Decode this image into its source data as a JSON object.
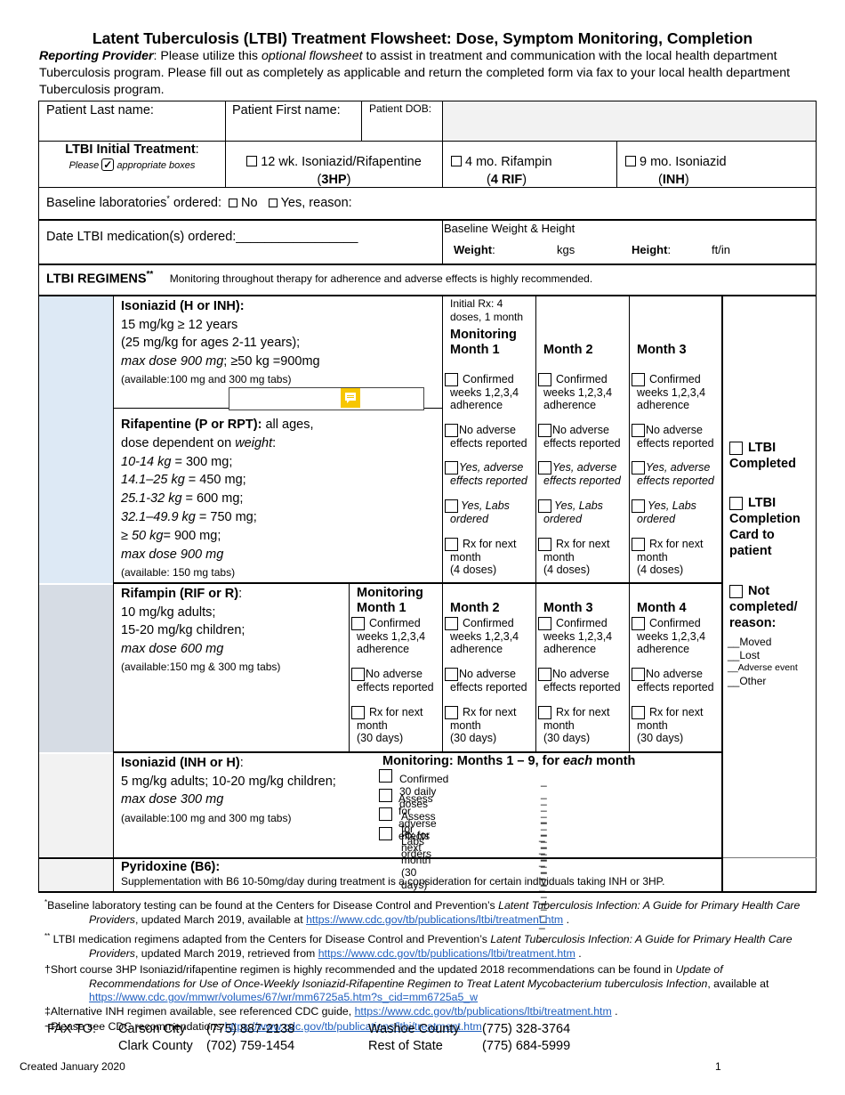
{
  "document": {
    "title": "Latent Tuberculosis (LTBI) Treatment Flowsheet: Dose, Symptom Monitoring, Completion",
    "intro_lead": "Reporting Provider",
    "intro_part1": ": Please utilize this ",
    "intro_italic": "optional flowsheet",
    "intro_part2": " to assist in treatment and communication with the local health department Tuberculosis program. Please fill out as completely as applicable and return the completed form via fax to your local health department Tuberculosis program."
  },
  "patient": {
    "last_name_label": "Patient Last name:",
    "first_name_label": "Patient First name:",
    "dob_label": "Patient DOB:"
  },
  "initial_treatment": {
    "label": "LTBI Initial Treatment",
    "colon": ":",
    "note_before": "Please",
    "note_after": "appropriate boxes",
    "options": [
      {
        "line1": "12 wk. Isoniazid/Rifapentine",
        "open": "(",
        "code": "3HP",
        "close": ")"
      },
      {
        "line1": "4 mo. Rifampin",
        "open": "(",
        "code": "4 RIF",
        "close": ")"
      },
      {
        "line1": "9 mo. Isoniazid",
        "open": "(",
        "code": "INH",
        "close": ")"
      }
    ]
  },
  "baseline_labs": {
    "label": "Baseline laboratories",
    "mark": "*",
    "ordered": " ordered:",
    "no": "No",
    "yes": "Yes, reason:"
  },
  "date_ordered": {
    "label": "Date LTBI medication(s) ordered:",
    "blank": "_________________"
  },
  "baseline_wh": {
    "title": "Baseline Weight & Height",
    "weight_label": "Weight",
    "weight_unit": "kgs",
    "height_label": "Height",
    "height_unit": "ft/in"
  },
  "regimens_header": {
    "title": "LTBI REGIMENS",
    "mark": "**",
    "note": "Monitoring throughout therapy for adherence and adverse effects is highly recommended."
  },
  "isoniazid_3hp": {
    "name": "Isoniazid (H or INH):",
    "line1": "15 mg/kg ≥ 12 years",
    "line2": "(25 mg/kg for ages 2-11 years);",
    "line3_italic": "max dose 900 mg",
    "line3_rest": "; ≥50 kg =900mg",
    "avail": "(available:100 mg and 300 mg tabs)"
  },
  "rifapentine": {
    "name": "Rifapentine (P or RPT):",
    "name_rest": " all ages,",
    "line1_a": "dose dependent on ",
    "line1_b": "weight",
    "line1_c": ":",
    "doses": [
      {
        "range": "10-14 kg",
        "dose": " = 300 mg;"
      },
      {
        "range": "14.1–25 kg",
        "dose": " = 450 mg;"
      },
      {
        "range": "25.1-32 kg",
        "dose": " = 600 mg;"
      },
      {
        "range": "32.1–49.9 kg",
        "dose": " = 750 mg;"
      },
      {
        "range": "≥ 50 kg",
        "dose": "= 900 mg;"
      }
    ],
    "max": "max dose 900 mg",
    "avail": "(available: 150 mg tabs)"
  },
  "hp_monitoring": {
    "initial_rx": "Initial Rx: 4 doses, 1 month",
    "months": [
      {
        "head1": "Monitoring",
        "head2": "Month 1"
      },
      {
        "head1": "",
        "head2": "Month 2"
      },
      {
        "head1": "",
        "head2": "Month 3"
      }
    ],
    "items": {
      "confirmed": [
        "Confirmed",
        "weeks 1,2,3,4",
        "adherence"
      ],
      "no_adverse": [
        "No adverse",
        "effects reported"
      ],
      "yes_adverse": [
        "Yes, adverse",
        "effects reported"
      ],
      "labs": [
        "Yes, Labs",
        "ordered"
      ],
      "rx": [
        "Rx for next",
        "month",
        "(4 doses)"
      ]
    }
  },
  "completion": {
    "completed": [
      "LTBI",
      "Completed"
    ],
    "card": [
      "LTBI",
      "Completion",
      "Card to",
      "patient"
    ],
    "not_completed": [
      "Not",
      "completed/",
      "reason:"
    ],
    "reasons": [
      "__Moved",
      "__Lost",
      "__Adverse event",
      "__Other"
    ]
  },
  "rifampin": {
    "name": "Rifampin (RIF or R)",
    "colon": ":",
    "line1": "10 mg/kg adults;",
    "line2": "15-20 mg/kg children;",
    "max": "max dose 600 mg",
    "avail": "(available:150 mg & 300 mg tabs)",
    "months": [
      {
        "head1": "Monitoring",
        "head2": "Month 1"
      },
      {
        "head1": "",
        "head2": "Month 2"
      },
      {
        "head1": "",
        "head2": "Month 3"
      },
      {
        "head1": "",
        "head2": "Month 4"
      }
    ],
    "items": {
      "confirmed": [
        "Confirmed",
        "weeks 1,2,3,4",
        "adherence"
      ],
      "no_adverse": [
        "No adverse",
        "effects reported"
      ],
      "rx": [
        "Rx for next",
        "month",
        "(30 days)"
      ]
    }
  },
  "isoniazid_9": {
    "name": "Isoniazid (INH or H)",
    "colon": ":",
    "line1": "5 mg/kg adults; 10-20 mg/kg children;",
    "max": "max dose 300 mg",
    "avail": "(available:100 mg and 300 mg tabs)",
    "monitor_a": "Monitoring: Months 1 – 9, for ",
    "monitor_b": "each",
    "monitor_c": " month",
    "items": [
      {
        "label": "Confirmed 30 daily doses",
        "blank": "_ _ _ _ _ _ _ _ _"
      },
      {
        "label": "Assess for adverse effects",
        "blank": "_ _ _ _ _ _ _ _ _"
      },
      {
        "label": "Assess for Labs orders",
        "blank": "_ _ _ _ _ _ _ _ _"
      },
      {
        "label": "Rx for next month (30 days)",
        "blank": "_ _ _ _ _ _ _ _ _"
      }
    ]
  },
  "pyridoxine": {
    "name": "Pyridoxine (B6):",
    "text": "Supplementation with B6 10-50mg/day during treatment is a consideration for certain individuals taking INH or 3HP."
  },
  "footnotes": {
    "f1_mark": "*",
    "f1_a": "Baseline laboratory testing can be found at the Centers for Disease Control and Prevention’s ",
    "f1_b": "Latent Tuberculosis Infection: A Guide for Primary Health Care",
    "f1_c": "Providers",
    "f1_d": ", updated March 2019, available at ",
    "f1_link": "https://www.cdc.gov/tb/publications/ltbi/treatment.htm",
    "f1_end": " .",
    "f2_mark": "**",
    "f2_a": " LTBI medication regimens adapted from the Centers for Disease Control and Prevention’s ",
    "f2_b": "Latent Tuberculosis Infection: A Guide for Primary Health Care",
    "f2_c": "Providers",
    "f2_d": ", updated March 2019, retrieved from ",
    "f2_link": "https://www.cdc.gov/tb/publications/ltbi/treatment.htm",
    "f2_end": " .",
    "f3_mark": "†",
    "f3_a": "Short course 3HP Isoniazid/rifapentine regimen is highly recommended and the updated 2018 recommendations can be found in ",
    "f3_b": "Update of",
    "f3_c": "Recommendations for Use of Once-Weekly Isoniazid-Rifapentine Regimen to Treat Latent Mycobacterium tuberculosis Infection",
    "f3_d": ", available at",
    "f3_link": "https://www.cdc.gov/mmwr/volumes/67/wr/mm6725a5.htm?s_cid=mm6725a5_w",
    "f4_mark": "‡",
    "f4_a": "Alternative INH regimen available, see referenced CDC guide, ",
    "f4_link": "https://www.cdc.gov/tb/publications/ltbi/treatment.htm",
    "f4_end": " .",
    "f5_mark": "~",
    "f5_a": "Please see CDC recommendations ",
    "f5_link": "https://www.cdc.gov/tb/publications/ltbi/treatment.htm"
  },
  "fax": {
    "label": "FAX TO:",
    "entries": [
      {
        "place": "Carson City",
        "phone": "(775) 887-2138"
      },
      {
        "place": "Washoe County",
        "phone": "(775) 328-3764"
      },
      {
        "place": "Clark County",
        "phone": "(702) 759-1454"
      },
      {
        "place": "Rest of State",
        "phone": "(775) 684-5999"
      }
    ]
  },
  "page_footer": {
    "created": "Created January 2020",
    "page": "1"
  },
  "colors": {
    "shade_3hp": "#dde9f5",
    "shade_rif": "#d6dce4",
    "shade_inh": "#f2f2f2",
    "patient_bg": "#f2f2f2",
    "link": "#1f5fbf",
    "comment_icon": "#f7c600"
  }
}
